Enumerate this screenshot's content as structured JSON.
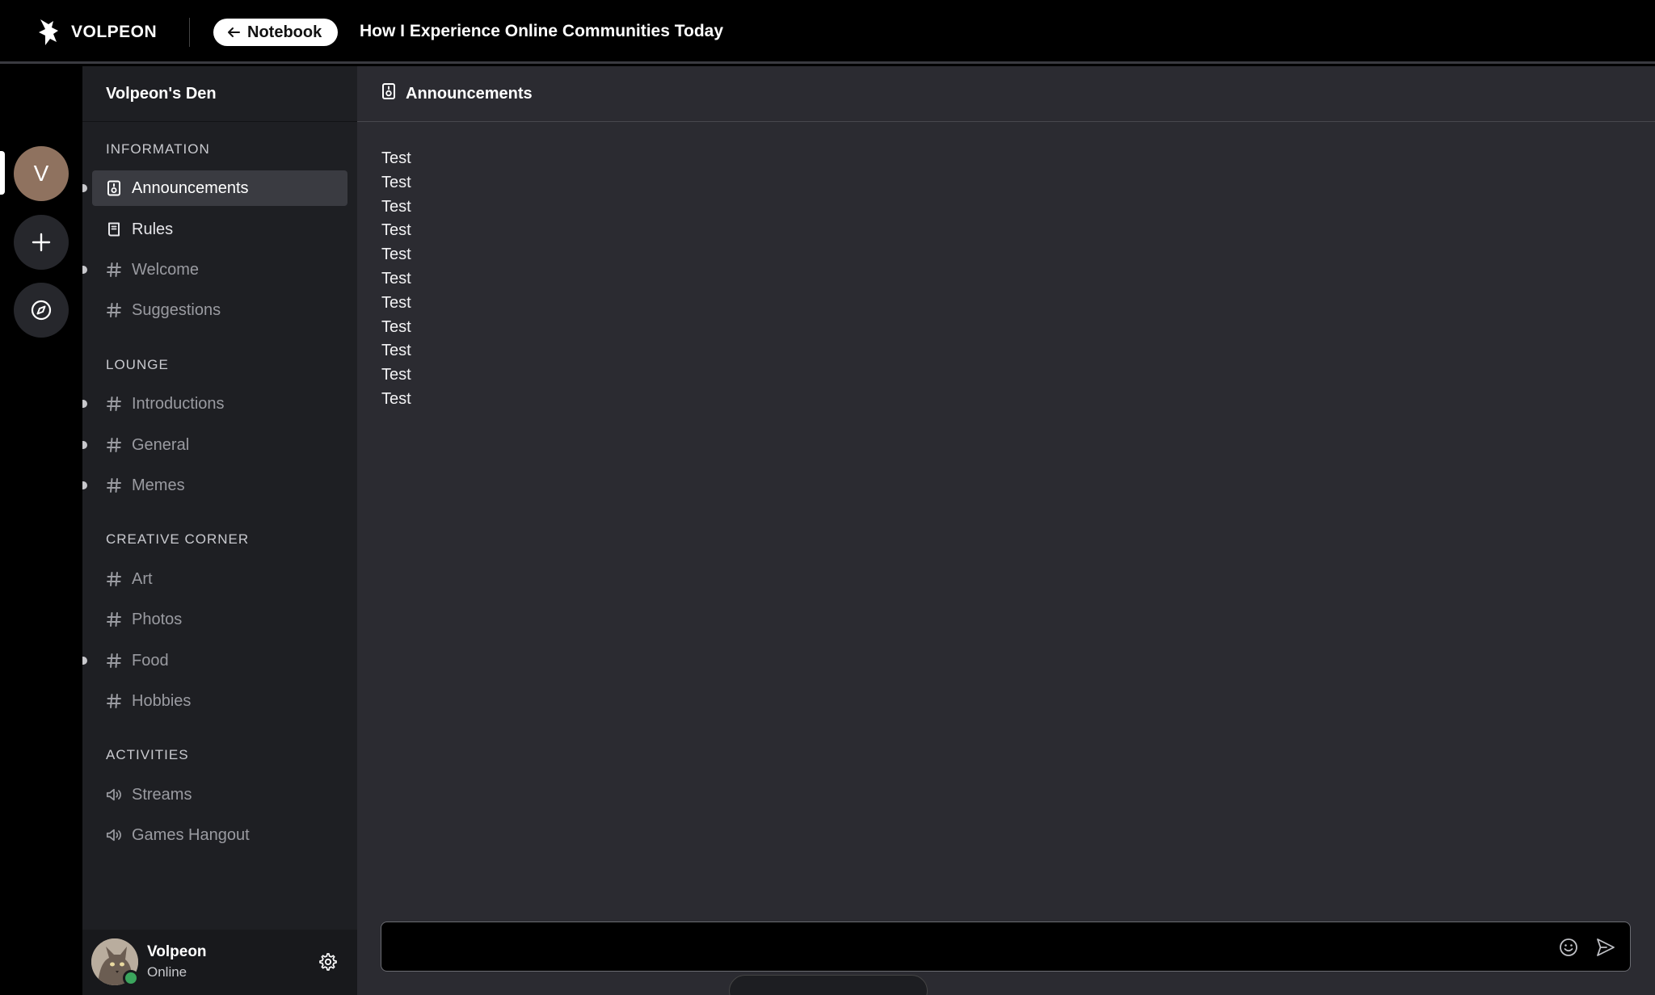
{
  "topbar": {
    "brand": "VOLPEON",
    "notebook_label": "Notebook",
    "title": "How I Experience Online Communities Today"
  },
  "rail": {
    "server_initial": "V"
  },
  "sidebar": {
    "server_name": "Volpeon's Den",
    "categories": [
      {
        "label": "INFORMATION"
      },
      {
        "label": "LOUNGE"
      },
      {
        "label": "CREATIVE CORNER"
      },
      {
        "label": "ACTIVITIES"
      }
    ],
    "channels": [
      {
        "label": "Announcements",
        "icon": "announcement-icon"
      },
      {
        "label": "Rules",
        "icon": "book-icon"
      },
      {
        "label": "Welcome",
        "icon": "hash-icon"
      },
      {
        "label": "Suggestions",
        "icon": "hash-icon"
      },
      {
        "label": "Introductions",
        "icon": "hash-icon"
      },
      {
        "label": "General",
        "icon": "hash-icon"
      },
      {
        "label": "Memes",
        "icon": "hash-icon"
      },
      {
        "label": "Art",
        "icon": "hash-icon"
      },
      {
        "label": "Photos",
        "icon": "hash-icon"
      },
      {
        "label": "Food",
        "icon": "hash-icon"
      },
      {
        "label": "Hobbies",
        "icon": "hash-icon"
      },
      {
        "label": "Streams",
        "icon": "speaker-icon"
      },
      {
        "label": "Games Hangout",
        "icon": "speaker-icon"
      }
    ]
  },
  "user": {
    "name": "Volpeon",
    "status": "Online"
  },
  "main": {
    "channel_title": "Announcements",
    "messages": [
      "Test",
      "Test",
      "Test",
      "Test",
      "Test",
      "Test",
      "Test",
      "Test",
      "Test",
      "Test",
      "Test"
    ],
    "composer_placeholder": ""
  }
}
